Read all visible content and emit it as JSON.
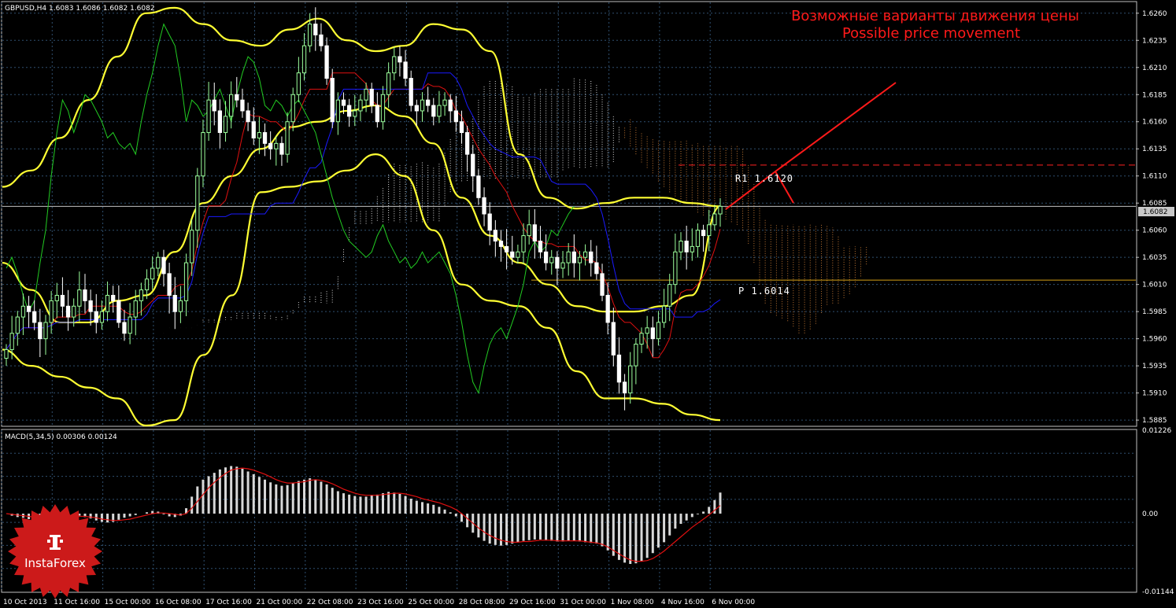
{
  "header": {
    "main_title": "GBPUSD,H4  1.6083 1.6086 1.6082 1.6082",
    "macd_title": "MACD(5,34,5) 0.00306 0.00124"
  },
  "annotation": {
    "line1": "Возможные варианты движения цены",
    "line2": "Possible price movement"
  },
  "levels": {
    "r1_label": "R1 1.6120",
    "p_label": "P 1.6014",
    "current_price": "1.6082"
  },
  "logo": {
    "text": "InstaForex"
  },
  "chart_data": [
    {
      "type": "candlestick",
      "symbol": "GBPUSD",
      "timeframe": "H4",
      "ohlc_last": {
        "open": 1.6083,
        "high": 1.6086,
        "low": 1.6082,
        "close": 1.6082
      },
      "ylim": [
        1.588,
        1.627
      ],
      "y_ticks": [
        "1.6260",
        "1.6235",
        "1.6210",
        "1.6185",
        "1.6160",
        "1.6135",
        "1.6110",
        "1.6085",
        "1.6060",
        "1.6035",
        "1.6010",
        "1.5985",
        "1.5960",
        "1.5935",
        "1.5910",
        "1.5885"
      ],
      "x_ticks": [
        "10 Oct 2013",
        "11 Oct 16:00",
        "15 Oct 00:00",
        "16 Oct 08:00",
        "17 Oct 16:00",
        "21 Oct 00:00",
        "22 Oct 08:00",
        "23 Oct 16:00",
        "25 Oct 00:00",
        "28 Oct 08:00",
        "29 Oct 16:00",
        "31 Oct 00:00",
        "1 Nov 08:00",
        "4 Nov 16:00",
        "6 Nov 00:00"
      ],
      "levels": [
        {
          "name": "R1",
          "value": 1.612,
          "style": "dashed",
          "color": "#ff2020"
        },
        {
          "name": "P",
          "value": 1.6014,
          "style": "solid",
          "color": "#d4a017"
        },
        {
          "name": "current",
          "value": 1.6082,
          "color": "#c0c0c0"
        }
      ],
      "close_series": [
        1.595,
        1.5965,
        1.598,
        1.599,
        1.5985,
        1.5975,
        1.596,
        1.5975,
        1.5995,
        1.6,
        1.599,
        1.598,
        1.599,
        1.6005,
        1.5995,
        1.5985,
        1.5975,
        1.5985,
        1.6,
        1.5995,
        1.5975,
        1.5965,
        1.598,
        1.5995,
        1.6005,
        1.6015,
        1.6025,
        1.6035,
        1.602,
        1.6,
        1.5985,
        1.5995,
        1.603,
        1.606,
        1.611,
        1.615,
        1.618,
        1.617,
        1.615,
        1.6165,
        1.6185,
        1.618,
        1.617,
        1.616,
        1.6145,
        1.615,
        1.614,
        1.6135,
        1.614,
        1.613,
        1.616,
        1.6185,
        1.6205,
        1.623,
        1.625,
        1.624,
        1.623,
        1.62,
        1.616,
        1.618,
        1.6175,
        1.6165,
        1.617,
        1.618,
        1.619,
        1.6175,
        1.616,
        1.6185,
        1.6205,
        1.622,
        1.6215,
        1.62,
        1.6175,
        1.617,
        1.618,
        1.6175,
        1.6165,
        1.6175,
        1.618,
        1.617,
        1.616,
        1.615,
        1.613,
        1.611,
        1.609,
        1.6075,
        1.606,
        1.605,
        1.6045,
        1.604,
        1.6035,
        1.604,
        1.6055,
        1.6065,
        1.605,
        1.604,
        1.603,
        1.6035,
        1.6025,
        1.603,
        1.604,
        1.603,
        1.6035,
        1.604,
        1.603,
        1.602,
        1.6,
        1.5975,
        1.5945,
        1.592,
        1.591,
        1.5935,
        1.5955,
        1.5965,
        1.597,
        1.596,
        1.5975,
        1.599,
        1.601,
        1.604,
        1.605,
        1.604,
        1.6045,
        1.606,
        1.6055,
        1.6065,
        1.6075,
        1.6082
      ],
      "bollinger": {
        "upper": [
          1.61,
          1.6115,
          1.6145,
          1.618,
          1.622,
          1.626,
          1.6265,
          1.625,
          1.6235,
          1.623,
          1.6245,
          1.6255,
          1.6235,
          1.6225,
          1.623,
          1.625,
          1.6245,
          1.6225,
          1.613,
          1.609,
          1.608,
          1.6085,
          1.609,
          1.609,
          1.6085,
          1.6082
        ],
        "middle": [
          1.603,
          1.6005,
          1.5975,
          1.5975,
          1.5995,
          1.6,
          1.604,
          1.6085,
          1.611,
          1.6135,
          1.6155,
          1.616,
          1.617,
          1.6175,
          1.6165,
          1.614,
          1.609,
          1.6055,
          1.603,
          1.601,
          1.599,
          1.5985,
          1.5985,
          1.599,
          1.6,
          1.6082
        ],
        "lower": [
          1.595,
          1.5935,
          1.5925,
          1.5915,
          1.5905,
          1.588,
          1.5885,
          1.5945,
          1.6,
          1.6095,
          1.61,
          1.6105,
          1.6115,
          1.613,
          1.611,
          1.606,
          1.601,
          1.5995,
          1.599,
          1.597,
          1.593,
          1.5905,
          1.5905,
          1.59,
          1.589,
          1.5885
        ]
      }
    },
    {
      "type": "bar",
      "name": "MACD(5,34,5)",
      "values_last": {
        "macd": 0.00306,
        "signal": 0.00124
      },
      "ylim": [
        -0.01144,
        0.01226
      ],
      "y_ticks": [
        "0.01226",
        "0.00",
        "-0.01144"
      ],
      "histogram": [
        0.0,
        -0.0003,
        -0.0005,
        -0.0006,
        -0.0008,
        -0.0006,
        -0.0004,
        -0.0006,
        -0.0008,
        -0.001,
        -0.0007,
        -0.0004,
        -0.0002,
        -0.0003,
        -0.0005,
        -0.0007,
        -0.001,
        -0.0012,
        -0.0013,
        -0.0012,
        -0.0009,
        -0.0006,
        -0.0004,
        -0.0002,
        0.0,
        0.0002,
        0.0004,
        0.0003,
        -0.0001,
        -0.0004,
        -0.0005,
        -0.0003,
        0.0008,
        0.0025,
        0.004,
        0.005,
        0.0055,
        0.006,
        0.0065,
        0.0068,
        0.007,
        0.0069,
        0.0066,
        0.0062,
        0.0058,
        0.0054,
        0.005,
        0.0046,
        0.0043,
        0.0041,
        0.0042,
        0.0045,
        0.0048,
        0.005,
        0.0052,
        0.005,
        0.0047,
        0.0043,
        0.0038,
        0.0033,
        0.003,
        0.0028,
        0.0026,
        0.0025,
        0.0025,
        0.0027,
        0.0028,
        0.003,
        0.0032,
        0.0031,
        0.0029,
        0.0026,
        0.0022,
        0.0019,
        0.0017,
        0.0015,
        0.0013,
        0.001,
        0.0006,
        0.0002,
        -0.0004,
        -0.0012,
        -0.002,
        -0.0028,
        -0.0035,
        -0.004,
        -0.0044,
        -0.0046,
        -0.0047,
        -0.0046,
        -0.0044,
        -0.0042,
        -0.004,
        -0.0039,
        -0.0038,
        -0.0038,
        -0.0039,
        -0.004,
        -0.0041,
        -0.0041,
        -0.004,
        -0.004,
        -0.0041,
        -0.0042,
        -0.0043,
        -0.0044,
        -0.0048,
        -0.0054,
        -0.0062,
        -0.0068,
        -0.0072,
        -0.0074,
        -0.0073,
        -0.007,
        -0.0065,
        -0.0058,
        -0.005,
        -0.0042,
        -0.0032,
        -0.0022,
        -0.0015,
        -0.001,
        -0.0005,
        -0.0001,
        0.0003,
        0.001,
        0.002,
        0.0031
      ],
      "signal": [
        0.0,
        -0.0001,
        -0.0002,
        -0.0003,
        -0.0004,
        -0.0005,
        -0.0005,
        -0.0005,
        -0.0006,
        -0.0007,
        -0.0007,
        -0.0006,
        -0.0005,
        -0.0004,
        -0.0004,
        -0.0005,
        -0.0006,
        -0.0008,
        -0.0009,
        -0.001,
        -0.001,
        -0.0009,
        -0.0008,
        -0.0006,
        -0.0004,
        -0.0002,
        0.0,
        0.0001,
        0.0001,
        0.0,
        -0.0001,
        -0.0002,
        0.0,
        0.0008,
        0.0018,
        0.0028,
        0.0038,
        0.0046,
        0.0053,
        0.0059,
        0.0064,
        0.0066,
        0.0067,
        0.0066,
        0.0064,
        0.0061,
        0.0058,
        0.0054,
        0.005,
        0.0047,
        0.0045,
        0.0045,
        0.0046,
        0.0047,
        0.0049,
        0.005,
        0.0049,
        0.0047,
        0.0044,
        0.004,
        0.0036,
        0.0033,
        0.003,
        0.0028,
        0.0027,
        0.0027,
        0.0027,
        0.0028,
        0.0029,
        0.003,
        0.003,
        0.0029,
        0.0027,
        0.0025,
        0.0022,
        0.002,
        0.0018,
        0.0016,
        0.0013,
        0.001,
        0.0006,
        0.0,
        -0.0007,
        -0.0014,
        -0.0021,
        -0.0027,
        -0.0032,
        -0.0036,
        -0.0039,
        -0.0041,
        -0.0042,
        -0.0042,
        -0.0041,
        -0.0041,
        -0.004,
        -0.0039,
        -0.0039,
        -0.0039,
        -0.004,
        -0.004,
        -0.004,
        -0.004,
        -0.004,
        -0.0041,
        -0.0042,
        -0.0043,
        -0.0045,
        -0.0049,
        -0.0054,
        -0.0059,
        -0.0064,
        -0.0068,
        -0.007,
        -0.007,
        -0.0069,
        -0.0066,
        -0.0061,
        -0.0055,
        -0.0048,
        -0.0041,
        -0.0034,
        -0.0027,
        -0.002,
        -0.0014,
        -0.0008,
        -0.0002,
        0.0005,
        0.0012
      ]
    }
  ],
  "colors": {
    "background": "#000000",
    "grid": "#2f4f6f",
    "bull_candle": "#9cff9c",
    "bear_candle": "#ffffff",
    "bollinger": "#ffff33",
    "ichimoku_tenkan": "#e01010",
    "ichimoku_kijun": "#1a1aff",
    "chikou": "#22cc22",
    "kumo_bull": "#ffffff",
    "kumo_bear": "#e08a3c",
    "histogram": "#d8d8d8",
    "signal": "#e01010",
    "annotation": "#ff1a1a",
    "logo": "#cc1a1a"
  }
}
